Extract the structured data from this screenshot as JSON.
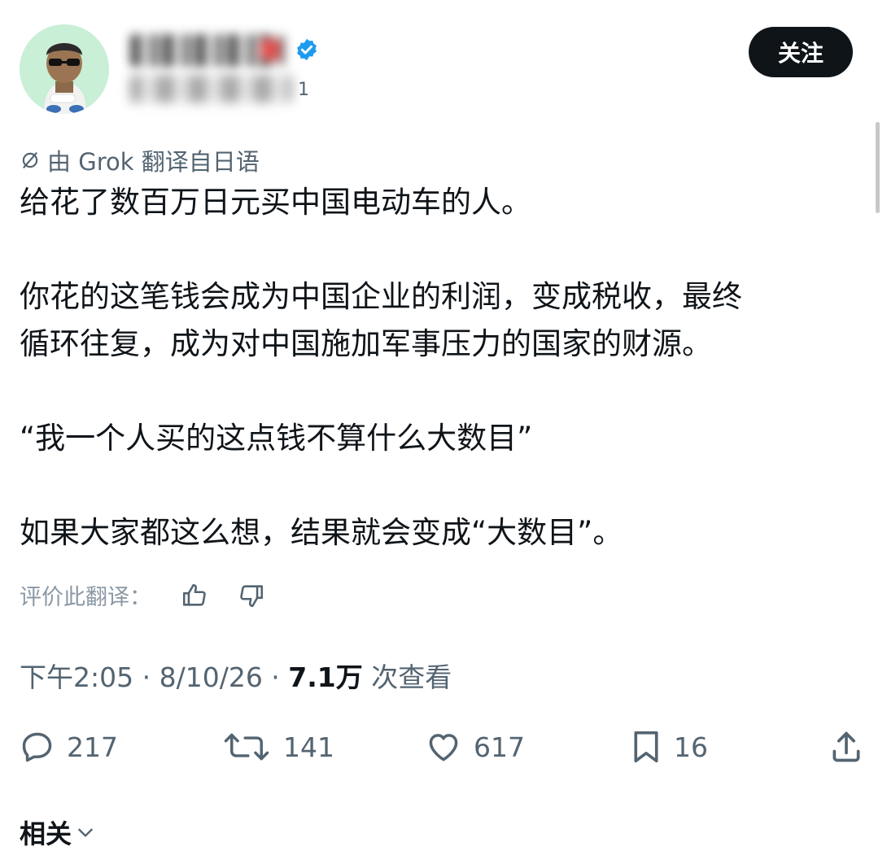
{
  "header": {
    "follow_label": "关注",
    "handle_tail": "1"
  },
  "post": {
    "translation_note": "由 Grok 翻译自日语",
    "paragraphs": [
      "给花了数百万日元买中国电动车的人。",
      "你花的这笔钱会成为中国企业的利润，变成税收，最终",
      "循环往复，成为对中国施加军事压力的国家的财源。",
      "“我一个人买的这点钱不算什么大数目”",
      "如果大家都这么想，结果就会变成“大数目”。"
    ],
    "rate_label": "评价此翻译："
  },
  "meta": {
    "time": "下午2:05",
    "sep1": " · ",
    "date": "8/10/26",
    "sep2": " · ",
    "views_count": "7.1万",
    "views_label": " 次查看"
  },
  "actions": {
    "reply_count": "217",
    "repost_count": "141",
    "like_count": "617",
    "bookmark_count": "16"
  },
  "related": {
    "label": "相关"
  },
  "colors": {
    "text": "#0f1419",
    "secondary": "#536471",
    "verified": "#1d9bf0",
    "avatar_bg": "#c9efd6"
  },
  "icons": [
    "translate-icon",
    "thumbs-up-icon",
    "thumbs-down-icon",
    "reply-icon",
    "repost-icon",
    "like-icon",
    "bookmark-icon",
    "share-icon",
    "chevron-down-icon",
    "verified-icon"
  ]
}
